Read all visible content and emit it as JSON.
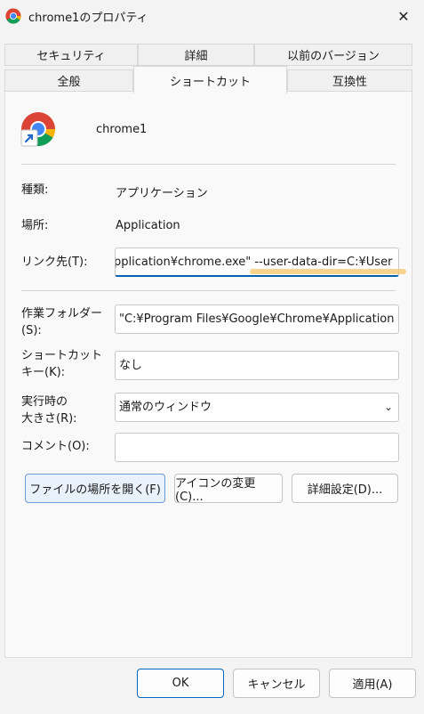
{
  "window": {
    "title": "chrome1のプロパティ",
    "close_glyph": "✕"
  },
  "tabs": {
    "row_top": [
      "セキュリティ",
      "詳細",
      "以前のバージョン"
    ],
    "row_bottom": [
      "全般",
      "ショートカット",
      "互換性"
    ],
    "active": "ショートカット"
  },
  "header": {
    "name": "chrome1",
    "icon": "chrome-shortcut-icon"
  },
  "fields": {
    "type_label": "種類:",
    "type_value": "アプリケーション",
    "location_label": "場所:",
    "location_value": "Application",
    "target_label": "リンク先(T):",
    "target_value": "pplication¥chrome.exe\" --user-data-dir=C:¥User",
    "workdir_label_1": "作業フォルダー",
    "workdir_label_2": "(S):",
    "workdir_value": "\"C:¥Program Files¥Google¥Chrome¥Application",
    "hotkey_label_1": "ショートカット",
    "hotkey_label_2": "キー(K):",
    "hotkey_value": "なし",
    "run_label_1": "実行時の",
    "run_label_2": "大きさ(R):",
    "run_value": "通常のウィンドウ",
    "comment_label": "コメント(O):",
    "comment_value": ""
  },
  "actions": {
    "open_location": "ファイルの場所を開く(F)",
    "change_icon": "アイコンの変更(C)...",
    "advanced": "詳細設定(D)..."
  },
  "footer": {
    "ok": "OK",
    "cancel": "キャンセル",
    "apply": "適用(A)"
  },
  "colors": {
    "accent": "#0063b1",
    "highlight": "#f5c56a"
  }
}
